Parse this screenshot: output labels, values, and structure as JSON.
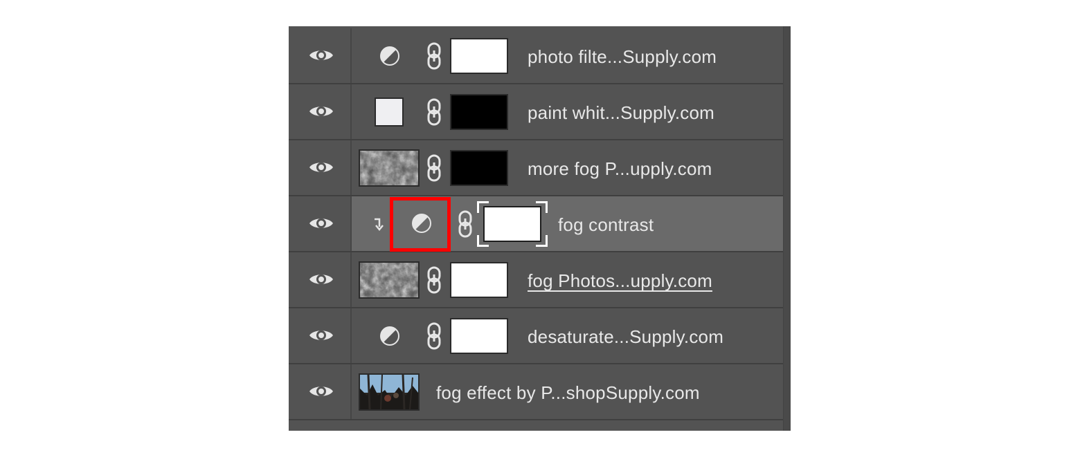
{
  "layers_panel": {
    "layers": [
      {
        "name": "photo filte...Supply.com",
        "thumb": "adjustment-icon",
        "mask": "white"
      },
      {
        "name": "paint whit...Supply.com",
        "thumb": "color-fill",
        "thumb_color": "#efeff2",
        "mask": "black"
      },
      {
        "name": "more fog P...upply.com",
        "thumb": "fog-texture",
        "mask": "black"
      },
      {
        "name": "fog contrast",
        "thumb": "adjustment-icon",
        "mask": "white",
        "selected": true,
        "clipped": true,
        "highlighted": true
      },
      {
        "name": "fog Photos...upply.com",
        "thumb": "fog-texture",
        "mask": "white",
        "underlined": true
      },
      {
        "name": "desaturate...Supply.com",
        "thumb": "adjustment-icon",
        "mask": "white"
      },
      {
        "name": "fog effect by P...shopSupply.com",
        "thumb": "photo",
        "mask": "none"
      }
    ]
  },
  "colors": {
    "panel_bg": "#535353",
    "selected_row_bg": "#6a6a6a",
    "highlight": "#ff0000",
    "text": "#e8e8e8"
  }
}
